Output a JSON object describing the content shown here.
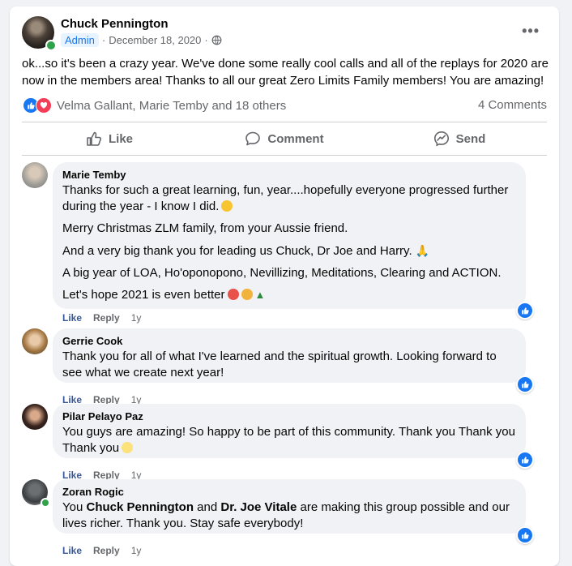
{
  "post": {
    "author": "Chuck Pennington",
    "badge": "Admin",
    "date": "December 18, 2020",
    "separator": "·",
    "more_icon": "more-icon",
    "text": "ok...so it's been a crazy year. We've done some really cool calls and all of the replays for 2020 are now in the members area! Thanks to all our great Zero Limits Family members! You are amazing!"
  },
  "reactions": {
    "names": "Velma Gallant, Marie Temby and 18 others",
    "comment_count": "4 Comments"
  },
  "actions": {
    "like": "Like",
    "comment": "Comment",
    "send": "Send"
  },
  "comments": [
    {
      "name": "Marie Temby",
      "paragraphs": [
        "Thanks for such a great learning, fun, year....hopefully everyone progressed further during the year - I know I did.",
        "Merry Christmas ZLM family, from your Aussie friend.",
        "And a very big thank you for leading us Chuck, Dr Joe and Harry.",
        "A big year of LOA, Ho'oponopono, Nevillizing, Meditations, Clearing and ACTION.",
        "Let's hope 2021 is even better"
      ],
      "like": "Like",
      "reply": "Reply",
      "age": "1y"
    },
    {
      "name": "Gerrie Cook",
      "text": "Thank you for all of what I've learned and the spiritual growth. Looking forward to see what we create next year!",
      "like": "Like",
      "reply": "Reply",
      "age": "1y"
    },
    {
      "name": "Pilar Pelayo Paz",
      "text": "You guys are amazing! So happy to be part of this community. Thank you Thank you Thank you",
      "like": "Like",
      "reply": "Reply",
      "age": "1y"
    },
    {
      "name": "Zoran Rogic",
      "text_prefix": "You",
      "mention1": "Chuck Pennington",
      "text_and": "and",
      "mention2": "Dr. Joe Vitale",
      "text_suffix": "are making this group possible and our lives richer. Thank you. Stay safe everybody!",
      "like": "Like",
      "reply": "Reply",
      "age": "1y"
    }
  ],
  "colors": {
    "accent": "#1877f2",
    "online": "#31a24c",
    "love": "#f33e58",
    "bubble": "#f0f2f5"
  }
}
